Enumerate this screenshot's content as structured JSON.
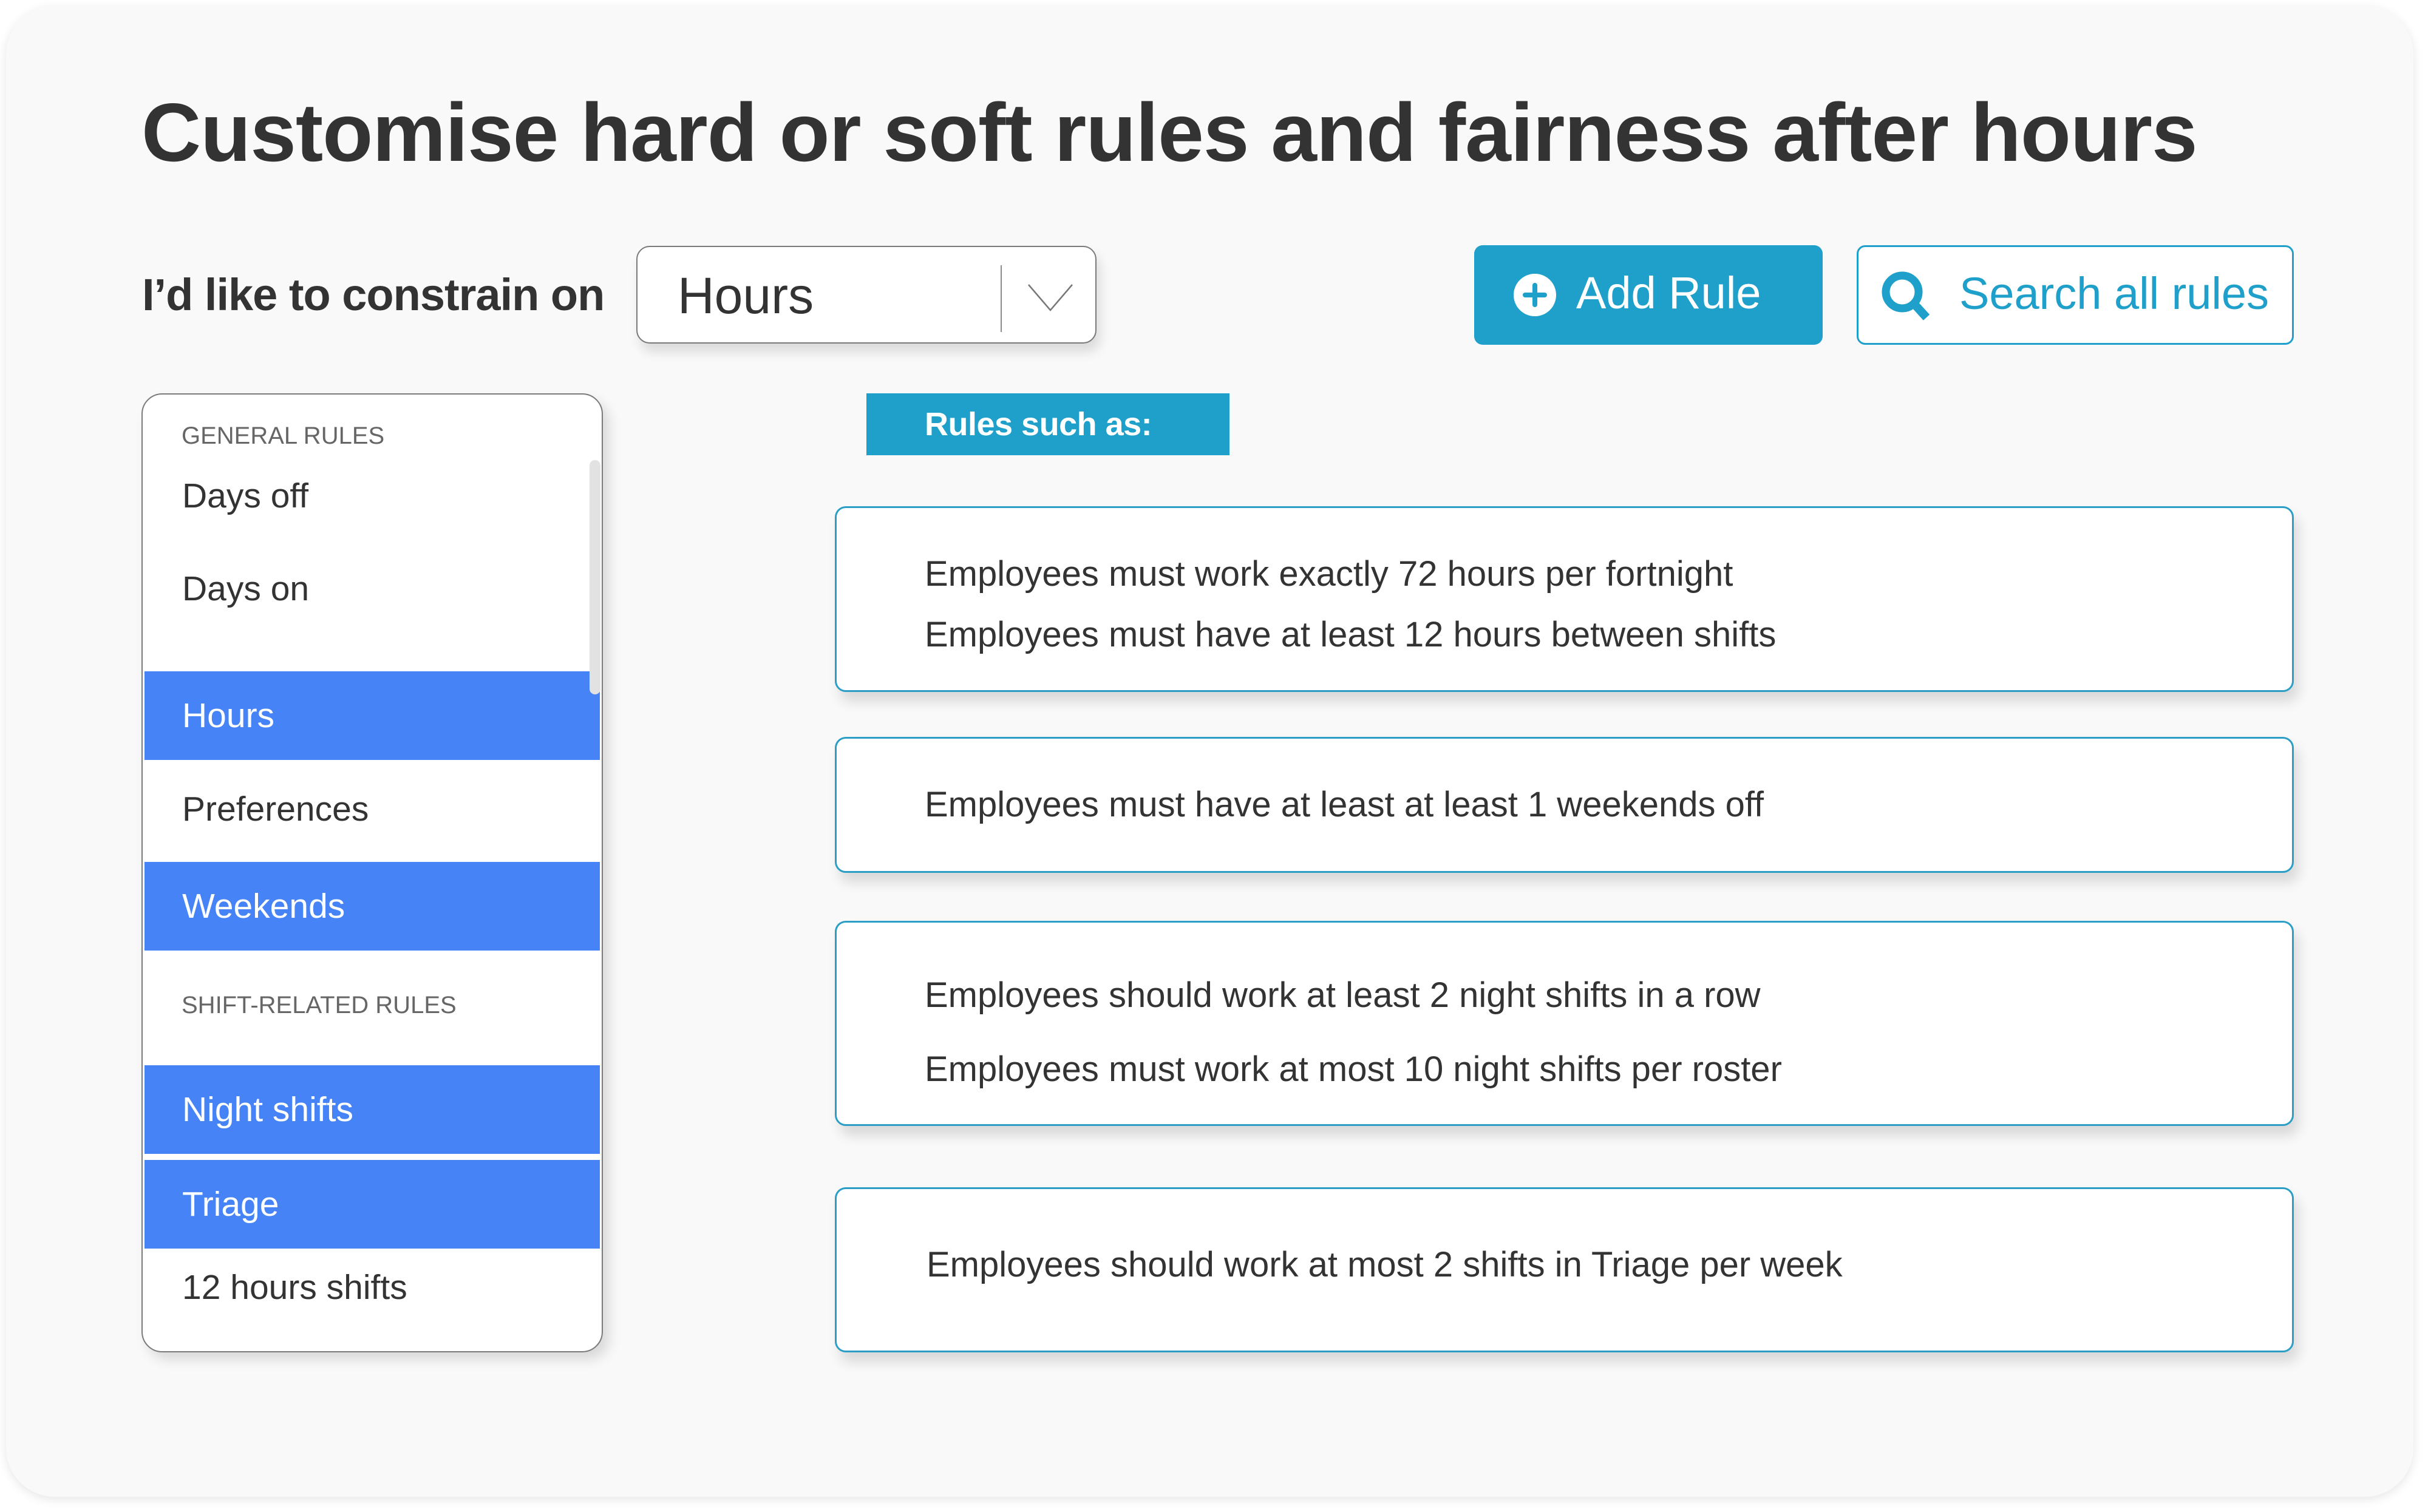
{
  "header": {
    "title": "Customise hard or soft rules and fairness after hours",
    "constrain_label": "I’d like to constrain on"
  },
  "constraint_select": {
    "selected": "Hours",
    "icon": "chevron-down-icon"
  },
  "toolbar": {
    "add_rule_label": "Add Rule",
    "add_rule_icon": "plus-circle-icon",
    "search_label": "Search all rules",
    "search_icon": "search-icon"
  },
  "sidebar": {
    "sections": [
      {
        "heading": "GENERAL RULES",
        "items": [
          {
            "label": "Days off",
            "selected": false
          },
          {
            "label": "Days on",
            "selected": false
          },
          {
            "label": "Hours",
            "selected": true
          },
          {
            "label": "Preferences",
            "selected": false
          },
          {
            "label": "Weekends",
            "selected": true
          }
        ]
      },
      {
        "heading": "SHIFT-RELATED RULES",
        "items": [
          {
            "label": "Night shifts",
            "selected": true
          },
          {
            "label": "Triage",
            "selected": true
          },
          {
            "label": "12 hours shifts",
            "selected": false
          }
        ]
      }
    ]
  },
  "rules": {
    "heading": "Rules such as:",
    "cards": [
      {
        "lines": [
          "Employees must work exactly 72 hours per fortnight",
          "Employees must have at least 12 hours between shifts"
        ]
      },
      {
        "lines": [
          "Employees must have at least at least 1 weekends off"
        ]
      },
      {
        "lines": [
          "Employees should work at least 2 night shifts in a row",
          "Employees must work at most 10 night shifts per roster"
        ]
      },
      {
        "lines": [
          "Employees should work at most 2 shifts in Triage per week"
        ]
      }
    ]
  },
  "colors": {
    "accent": "#1fa0cb",
    "selected_item": "#4583f6",
    "text": "#333333",
    "frame_bg": "#f9f9f9"
  }
}
